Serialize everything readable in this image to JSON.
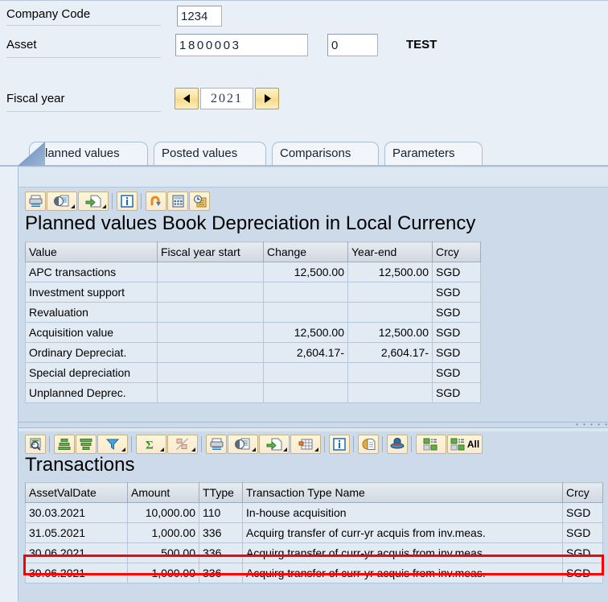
{
  "header": {
    "company_code_label": "Company Code",
    "company_code_value": "1234",
    "asset_label": "Asset",
    "asset_value": "1800003",
    "asset_subnumber_value": "0",
    "asset_description": "TEST",
    "fiscal_year_label": "Fiscal year",
    "fiscal_year_value": "2021",
    "fiscal_year_prev_icon": "arrow-left-icon",
    "fiscal_year_next_icon": "arrow-right-icon"
  },
  "tabs": [
    {
      "label": "Planned values",
      "active": true
    },
    {
      "label": "Posted values",
      "active": false
    },
    {
      "label": "Comparisons",
      "active": false
    },
    {
      "label": "Parameters",
      "active": false
    }
  ],
  "planned_values": {
    "title": "Planned values Book Depreciation in Local Currency",
    "toolbar": [
      {
        "name": "print-icon",
        "label": "Print"
      },
      {
        "name": "print-preview-icon",
        "label": "Print Preview",
        "has_menu": true
      },
      {
        "name": "export-icon",
        "label": "Export",
        "has_menu": true
      },
      {
        "name": "info-icon",
        "label": "Information"
      },
      {
        "name": "undo-icon",
        "label": "Undo"
      },
      {
        "name": "calculator-icon",
        "label": "Calculator"
      },
      {
        "name": "history-icon",
        "label": "History"
      }
    ],
    "columns": [
      "Value",
      "Fiscal year start",
      "Change",
      "Year-end",
      "Crcy"
    ],
    "rows": [
      {
        "value": "APC transactions",
        "fiscal_year_start": "",
        "change": "12,500.00",
        "year_end": "12,500.00",
        "crcy": "SGD"
      },
      {
        "value": "Investment support",
        "fiscal_year_start": "",
        "change": "",
        "year_end": "",
        "crcy": "SGD"
      },
      {
        "value": "Revaluation",
        "fiscal_year_start": "",
        "change": "",
        "year_end": "",
        "crcy": "SGD"
      },
      {
        "value": "Acquisition value",
        "fiscal_year_start": "",
        "change": "12,500.00",
        "year_end": "12,500.00",
        "crcy": "SGD"
      },
      {
        "value": "Ordinary Depreciat.",
        "fiscal_year_start": "",
        "change": "2,604.17-",
        "year_end": "2,604.17-",
        "crcy": "SGD"
      },
      {
        "value": "Special depreciation",
        "fiscal_year_start": "",
        "change": "",
        "year_end": "",
        "crcy": "SGD"
      },
      {
        "value": "Unplanned Deprec.",
        "fiscal_year_start": "",
        "change": "",
        "year_end": "",
        "crcy": "SGD"
      }
    ]
  },
  "transactions": {
    "title": "Transactions",
    "toolbar": [
      {
        "name": "detail-magnifier-icon",
        "label": "Display Detail"
      },
      {
        "name": "sort-ascending-icon",
        "label": "Sort Ascending"
      },
      {
        "name": "sort-descending-icon",
        "label": "Sort Descending"
      },
      {
        "name": "filter-icon",
        "label": "Filter",
        "has_menu": true
      },
      {
        "name": "sum-total-icon",
        "label": "Total",
        "has_menu": true
      },
      {
        "name": "subtotal-icon",
        "label": "Subtotals",
        "has_menu": true
      },
      {
        "name": "print-icon",
        "label": "Print"
      },
      {
        "name": "print-preview-icon",
        "label": "Print Preview",
        "has_menu": true
      },
      {
        "name": "export-icon",
        "label": "Export",
        "has_menu": true
      },
      {
        "name": "spreadsheet-icon",
        "label": "Views",
        "has_menu": true
      },
      {
        "name": "info-icon",
        "label": "Information"
      },
      {
        "name": "document-icon",
        "label": "Document"
      },
      {
        "name": "hat-icon",
        "label": "Simulation"
      },
      {
        "name": "layout-select-icon",
        "label": "Select Layout"
      },
      {
        "name": "layout-all-icon",
        "label": "All",
        "badge": "All"
      }
    ],
    "columns": [
      "AssetValDate",
      "Amount",
      "TType",
      "Transaction Type Name",
      "Crcy"
    ],
    "rows": [
      {
        "date": "30.03.2021",
        "amount": "10,000.00",
        "ttype": "110",
        "name": "In-house acquisition",
        "crcy": "SGD"
      },
      {
        "date": "31.05.2021",
        "amount": "1,000.00",
        "ttype": "336",
        "name": "Acquirg transfer of curr-yr acquis from inv.meas.",
        "crcy": "SGD"
      },
      {
        "date": "30.06.2021",
        "amount": "500.00",
        "ttype": "336",
        "name": "Acquirg transfer of curr-yr acquis from inv.meas.",
        "crcy": "SGD"
      },
      {
        "date": "30.06.2021",
        "amount": "1,000.00",
        "ttype": "336",
        "name": "Acquirg transfer of curr-yr acquis from inv.meas.",
        "crcy": "SGD"
      }
    ]
  },
  "colors": {
    "highlight_red": "#ff0000",
    "selected_yellow": "#ffff00",
    "cell_cyan": "#b3e9f5",
    "cell_green": "#cdf0c3",
    "cell_tan": "#fcd99a",
    "page_background": "#e9eff7"
  }
}
